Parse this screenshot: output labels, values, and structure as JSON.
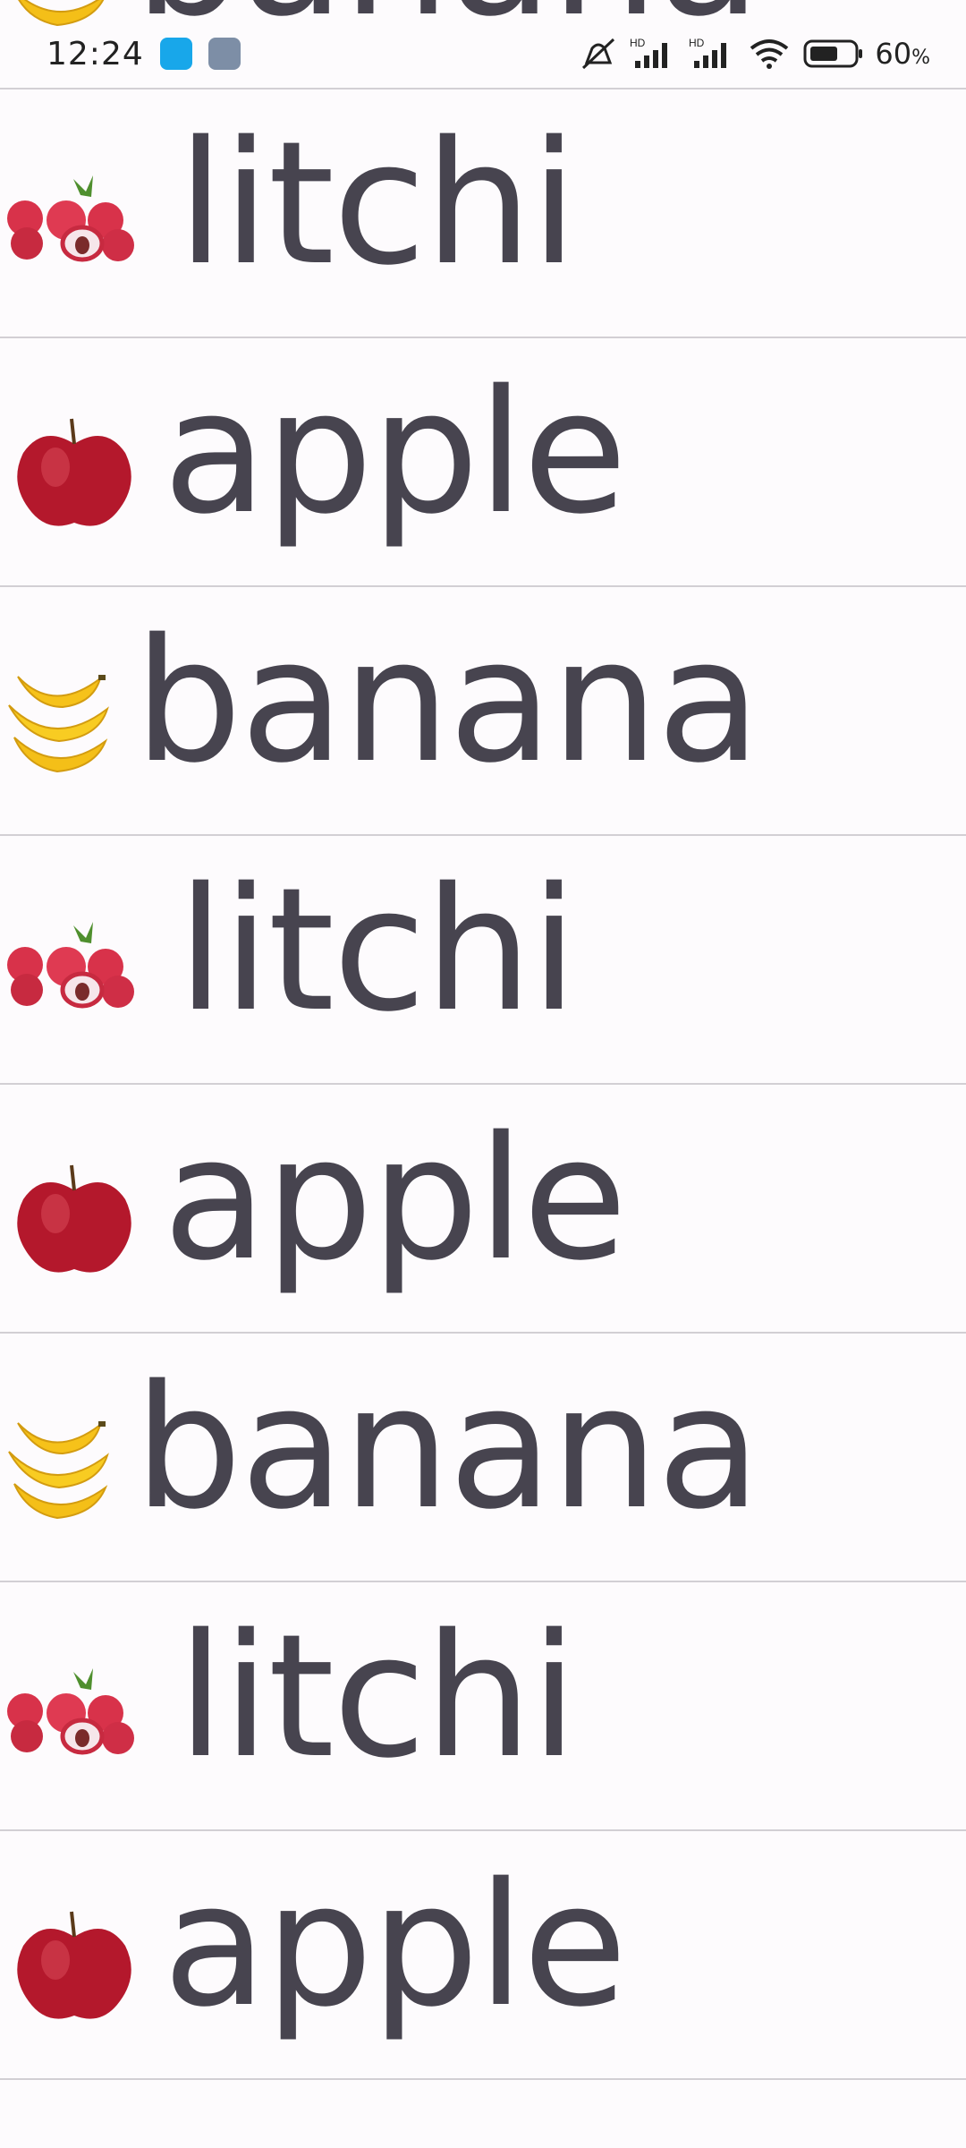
{
  "status_bar": {
    "time": "12:24",
    "battery_percent": "60",
    "battery_unit": "%",
    "icons": [
      "notification-app-icon",
      "tools-app-icon",
      "vibrate-mute-icon",
      "hd-signal-icon",
      "hd-signal-icon",
      "wifi-icon",
      "battery-icon"
    ],
    "colors": {
      "app_blue": "#18a7ea",
      "app_gray": "#7d8ea6"
    }
  },
  "list": {
    "items": [
      {
        "label": "banana",
        "icon": "banana-icon"
      },
      {
        "label": "litchi",
        "icon": "litchi-icon"
      },
      {
        "label": "apple",
        "icon": "apple-icon"
      },
      {
        "label": "banana",
        "icon": "banana-icon"
      },
      {
        "label": "litchi",
        "icon": "litchi-icon"
      },
      {
        "label": "apple",
        "icon": "apple-icon"
      },
      {
        "label": "banana",
        "icon": "banana-icon"
      },
      {
        "label": "litchi",
        "icon": "litchi-icon"
      },
      {
        "label": "apple",
        "icon": "apple-icon"
      }
    ],
    "text_color": "#47444f",
    "divider_color": "#d2cfd4",
    "background": "#fdfbfd"
  }
}
